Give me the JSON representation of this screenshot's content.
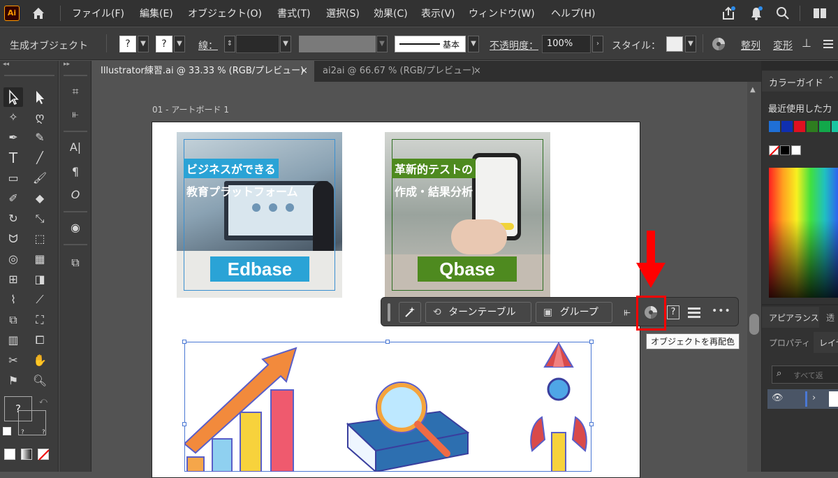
{
  "app": {
    "logo": "Ai"
  },
  "menu": [
    "ファイル(F)",
    "編集(E)",
    "オブジェクト(O)",
    "書式(T)",
    "選択(S)",
    "効果(C)",
    "表示(V)",
    "ウィンドウ(W)",
    "ヘルプ(H)"
  ],
  "control": {
    "label": "生成オブジェクト",
    "q1": "?",
    "q2": "?",
    "stroke_label": "線：",
    "stroke_style": "基本",
    "opacity_label": "不透明度：",
    "opacity_value": "100%",
    "style_label": "スタイル：",
    "align": "整列",
    "transform": "変形"
  },
  "tabs": [
    {
      "label": "Illustrator練習.ai @ 33.33 % (RGB/プレビュー)",
      "close": "×"
    },
    {
      "label": "ai2ai @ 66.67 % (RGB/プレビュー)",
      "close": "×"
    }
  ],
  "artboard": {
    "label": "01 - アートボード 1"
  },
  "cards": [
    {
      "line1": "ビジネスができる",
      "line2": "教育プラットフォーム",
      "brand": "Edbase"
    },
    {
      "line1": "革新的テストの",
      "line2": "作成・結果分析",
      "brand": "Qbase"
    }
  ],
  "context_bar": {
    "turntable": "ターンテーブル",
    "group": "グループ",
    "help": "?",
    "more": "•••"
  },
  "tooltip": "オブジェクトを再配色",
  "right_panel": {
    "color_guide": "カラーガイド",
    "recent": "最近使用した力",
    "appearance": "アピアランス",
    "appearance_extra": "透",
    "properties": "プロパティ",
    "layers": "レイヤ",
    "search_placeholder": "すべて返"
  },
  "toolbar": {
    "fill_q": "?",
    "mini_q1": "?",
    "mini_q2": "?"
  },
  "colors": {
    "edbase": "#2aa3d6",
    "qbase": "#4e8a1f",
    "ctx": "#464646",
    "highlight": "#ff0000",
    "arrow": "#ff0000",
    "menubar": "#323232"
  },
  "swatches": [
    "#1f6fd6",
    "#0f2fb0",
    "#e01020",
    "#2e7d1f",
    "#12a84a",
    "#18c6a0"
  ]
}
